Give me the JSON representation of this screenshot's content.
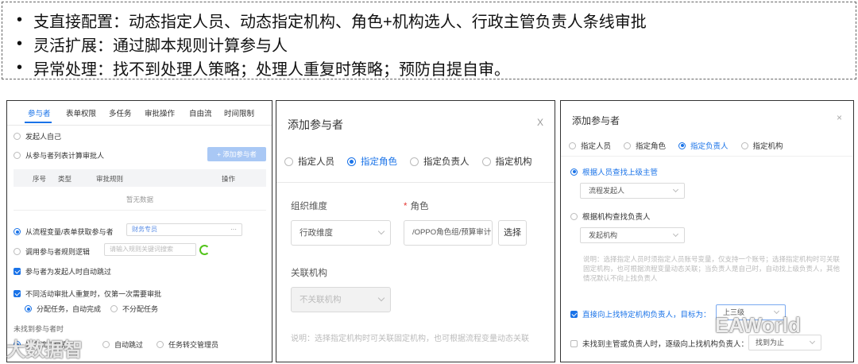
{
  "bullets": [
    "支直接配置：动态指定人员、动态指定机构、角色+机构选人、行政主管负责人条线审批",
    "灵活扩展：通过脚本规则计算参与人",
    "异常处理：找不到处理人策略；处理人重复时策略；预防自提自审。"
  ],
  "panel1": {
    "tabs": [
      "参与者",
      "表单权限",
      "多任务",
      "审批操作",
      "自由流",
      "时间限制"
    ],
    "opt_initiator": "发起人自己",
    "opt_list": "从参与者列表计算审批人",
    "add_button": "+ 添加参与者",
    "table_headers": [
      "序号",
      "类型",
      "审批规则",
      "操作"
    ],
    "empty_text": "暂无数据",
    "opt_var": "从流程变量/表单获取参与者",
    "var_value": "财务专员",
    "var_more": "···",
    "opt_rule": "调用参与者规则逻辑",
    "rule_placeholder": "请输入规则关键词搜索",
    "chk_auto_skip": "参与者为发起人时自动跳过",
    "chk_repeat": "不同活动审批人重复时，仅第一次需要审批",
    "sub_opt1": "分配任务，自动完成",
    "sub_opt2": "不分配任务",
    "not_found_label": "未找到参与者时",
    "nf_opt1": "异常流转异常",
    "nf_opt2": "自动跳过",
    "nf_opt3": "任务转交管理员"
  },
  "panel2": {
    "title": "添加参与者",
    "close": "X",
    "radios": [
      "指定人员",
      "指定角色",
      "指定负责人",
      "指定机构"
    ],
    "org_dim_label": "组织维度",
    "org_dim_value": "行政维度",
    "role_label": "角色",
    "role_required": "*",
    "role_value": "/OPPO角色组/预算审计",
    "choose_button": "选择",
    "rel_org_label": "关联机构",
    "rel_org_value": "不关联机构",
    "note": "说明：选择指定机构时可关联固定机构，也可根据流程变量动态关联"
  },
  "panel3": {
    "title": "添加参与者",
    "close": "×",
    "radios": [
      "指定人员",
      "指定角色",
      "指定负责人",
      "指定机构"
    ],
    "opt_by_person": "根据人员查找上级主管",
    "person_select": "流程发起人",
    "opt_by_org": "根据机构查找负责人",
    "org_select": "发起机构",
    "note": "说明：选择指定人员时须指定人员账号变量，仅支持一个账号；选择指定机构时可关联固定机构，也可根据流程变量动态关联；当负责人是自己时，自动找上级负责人，其他情况默认不向上找负责人",
    "chk_up": "直接向上找特定机构负责人，目标为：",
    "up_value": "上三级",
    "chk_not_found": "未找到主管或负责人时，逐级向上找机构负责人：",
    "not_found_value": "找到为止"
  },
  "watermark_left": "大数据智",
  "watermark_right": "EAWorld"
}
